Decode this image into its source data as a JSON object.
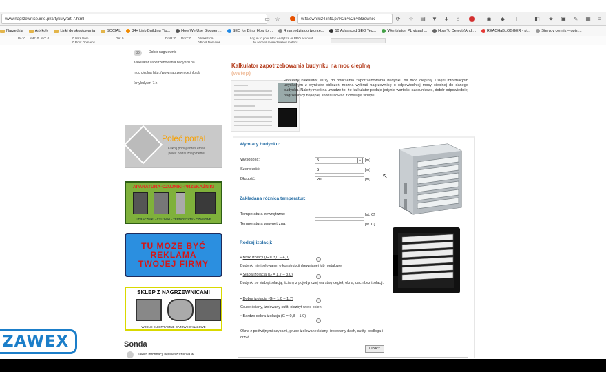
{
  "browser": {
    "url_left": "www.nagrzewnice.info.pl/artykuly/art-7.html",
    "url_left_bold": "nagrzewnice.info.pl",
    "url_right": "w.falowniki24.info.pl/%25%C5%83owniki"
  },
  "bookmarks": [
    {
      "label": "Narzędzia",
      "type": "folder"
    },
    {
      "label": "Artykuły",
      "type": "folder"
    },
    {
      "label": "Linki do skopiowania",
      "type": "folder"
    },
    {
      "label": "SOCIAL",
      "type": "folder"
    },
    {
      "label": "34+ Link-Building Tip...",
      "type": "site",
      "color": "#f08a00"
    },
    {
      "label": "How We Use Blogger ...",
      "type": "site",
      "color": "#555555"
    },
    {
      "label": "SEO for Bing: How to ...",
      "type": "site",
      "color": "#1e88e5"
    },
    {
      "label": "4 narzędzia do tworze...",
      "type": "site",
      "color": "#888888"
    },
    {
      "label": "10 Advanced SEO Tec...",
      "type": "site",
      "color": "#333333"
    },
    {
      "label": "'Wentylator' PL visual ...",
      "type": "site",
      "color": "#43a047"
    },
    {
      "label": "How To Detect (And ...",
      "type": "site",
      "color": "#666666"
    },
    {
      "label": "REACHaBLOGGER - pl...",
      "type": "site",
      "color": "#e53935"
    },
    {
      "label": "Sterydy cennik – opis ...",
      "type": "site",
      "color": "#999999"
    }
  ],
  "moz": {
    "pa": "PA: 0",
    "mr": "mR: 0",
    "mt": "mT: 0",
    "links1": "0 links from",
    "root1": "0 Root Domains",
    "da": "DA: 0",
    "dmr": "DmR: 0",
    "dmt": "DmT: 0",
    "links2": "0 links from",
    "root2": "0 Root Domains",
    "login": "Log in to your Moz Analytics or PRO account",
    "login2": "to access more detailed metrics"
  },
  "sidebar": {
    "badge": "30",
    "item_title": "Dobór nagrzewnic",
    "lines": [
      "Kalkulator zapotrzebowania budynku na",
      "moc cieplną http://www.nagrzewnice.info.pl/",
      "/artykuly/art-7.h"
    ],
    "polec_title": "Poleć portal",
    "polec_sub1": "Kliknij podaj adres email",
    "polec_sub2": "poleć portal znajomemu",
    "ad1_title": "APARATURA-CZUJNIKI-PRZEKAŹNIKI",
    "ad1_footer": "UTRACZNIKI - CZUJNIKI - TERMOSTATY - CZASOWE",
    "ad2_line1": "TU MOŻE BYĆ",
    "ad2_line2": "REKLAMA",
    "ad2_line3": "TWOJEJ FIRMY",
    "ad3_title": "SKLEP Z NAGRZEWNICAMI",
    "ad3_footer": "WODNE-ELEKTRYCZNE-GAZOWE-KANAŁOWE",
    "sonda_title": "Sonda",
    "sonda_q": "Jakich informacji będziesz szukała w"
  },
  "main": {
    "title": "Kalkulator zapotrzebowania budynku na moc cieplną",
    "title2": "(wstęp)",
    "intro": "Poniższy kalkulator służy do obliczenia zapotrzebowania budynku na moc cieplną. Dzięki informacjom uzyskanym z wyników obliczeń można wybrać nagrzewnicę o odpowiedniej mocy cieplnej do danego budynku. Należy mieć na uwadze to, że kalkulator podaje jedynie wartości szacunkowe, dobór odpowiedniej nagrzewnicy najlepiej skonsultować z obsługą sklepu.",
    "sec_dim": "Wymiary budynku:",
    "dim": [
      {
        "label": "Wysokość:",
        "value": "5",
        "unit": "[m]"
      },
      {
        "label": "Szerokość:",
        "value": "5",
        "unit": "[m]"
      },
      {
        "label": "Długość:",
        "value": "20",
        "unit": "[m]"
      }
    ],
    "sec_temp": "Zakładana różnica temperatur:",
    "temp": [
      {
        "label": "Temperatura zewnętrzna:",
        "value": "",
        "unit": "[st. C]"
      },
      {
        "label": "Temperatura wewnętrzna:",
        "value": "",
        "unit": "[st. C]"
      }
    ],
    "sec_iso": "Rodzaj izolacji:",
    "iso": [
      {
        "label": "Brak izolacji (G = 3,0 – 4,0)",
        "desc": "Budynki nie izolowane, o konstrukcji drewnianej lub metalowej"
      },
      {
        "label": "Słaba izolacja (G = 1,7 – 3,0)",
        "desc": "Budynki ze słabą izolacją, ściany z pojedynczej warstwy cegieł, okna, dach bez izolacji."
      },
      {
        "label": "Dobra izolacja (G = 1,0 – 1,7)",
        "desc": "Grube ściany, izolowany sufit, niezbyt wiele okien"
      },
      {
        "label": "Bardzo dobra izolacja (G = 0,8 – 1,0)",
        "desc": "Okna z podwójnymi szybami, grube izolowane ściany, izolowany dach, sufity, podłoga i drzwi."
      }
    ],
    "button": "Oblicz"
  },
  "logo": "ZAWEX"
}
